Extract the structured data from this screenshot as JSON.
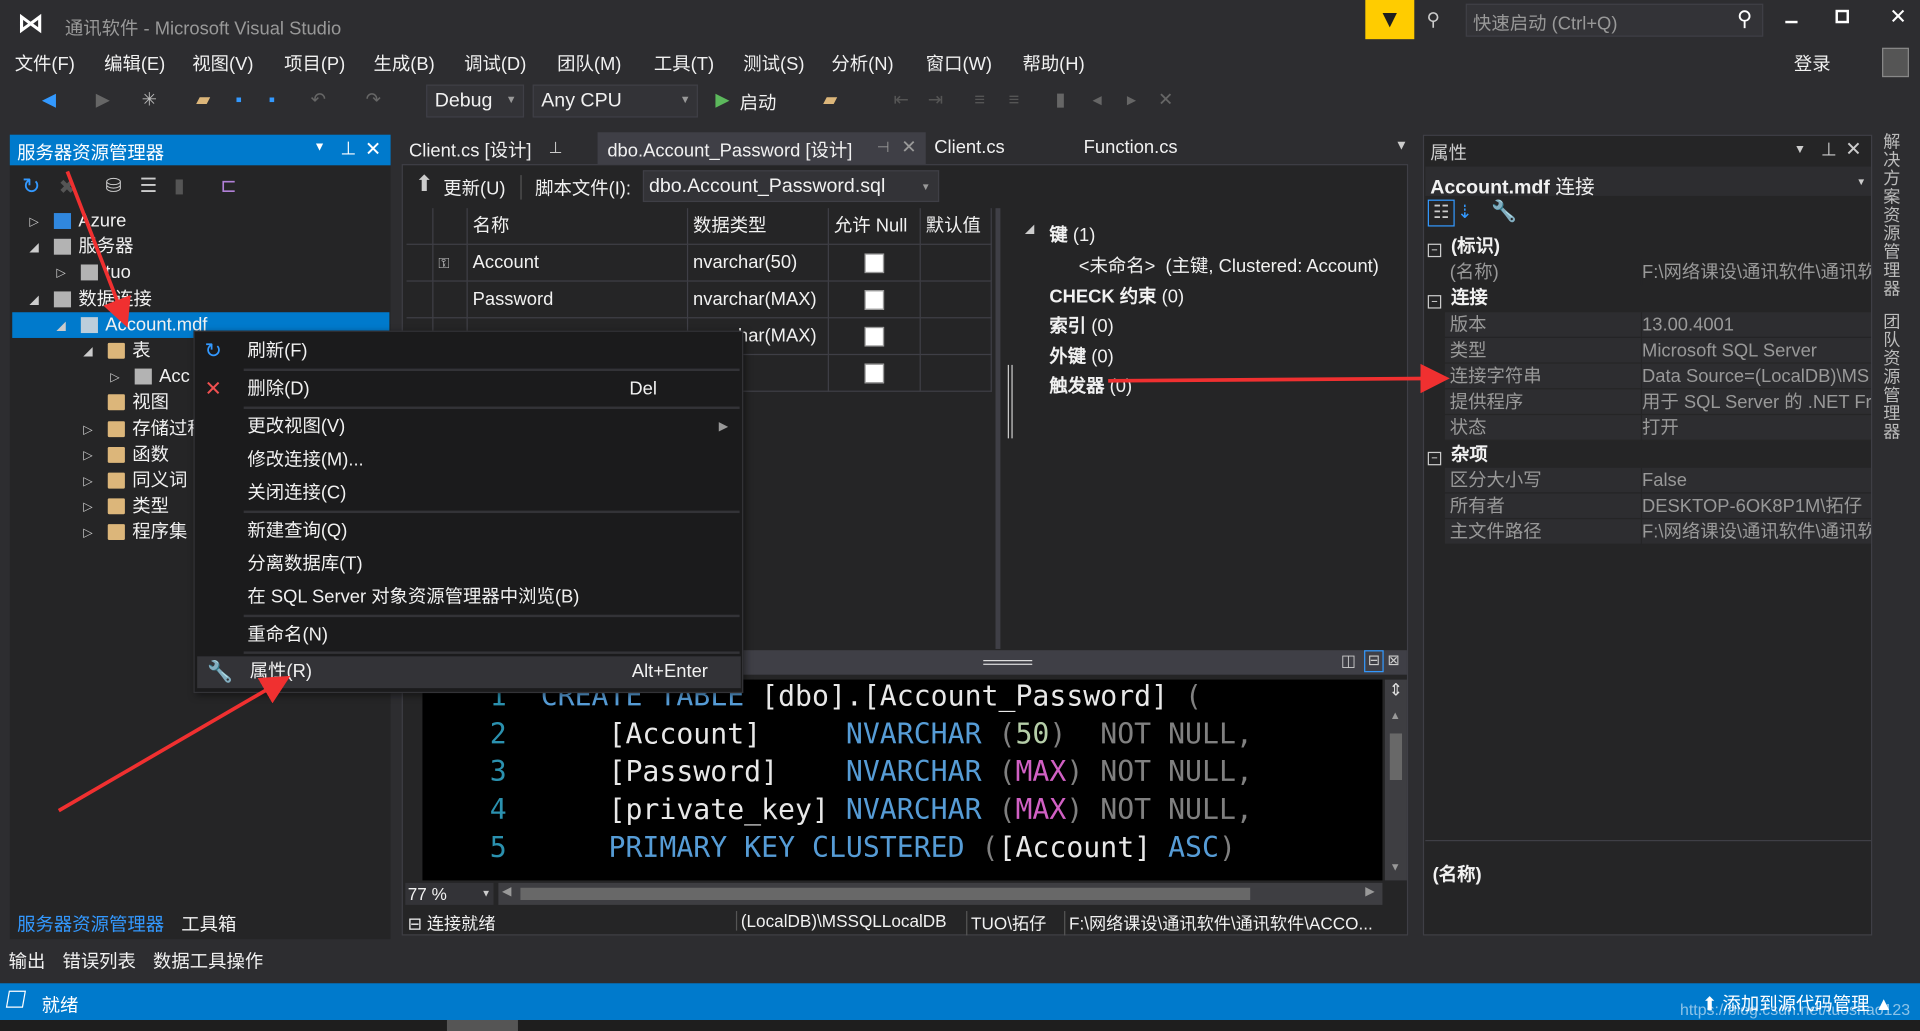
{
  "titlebar": {
    "title": "通讯软件 - Microsoft Visual Studio",
    "quick_launch_placeholder": "快速启动 (Ctrl+Q)",
    "accent": "#ffcc00"
  },
  "menu": {
    "items": [
      "文件(F)",
      "编辑(E)",
      "视图(V)",
      "项目(P)",
      "生成(B)",
      "调试(D)",
      "团队(M)",
      "工具(T)",
      "测试(S)",
      "分析(N)",
      "窗口(W)",
      "帮助(H)"
    ],
    "login": "登录"
  },
  "toolbar": {
    "config": "Debug",
    "platform": "Any CPU",
    "start": "启动"
  },
  "server_explorer": {
    "title": "服务器资源管理器",
    "tree": [
      {
        "label": "Azure",
        "icon": "azure-icon",
        "expander": "collapsed",
        "level": 0
      },
      {
        "label": "服务器",
        "icon": "server-icon",
        "expander": "expanded",
        "level": 0
      },
      {
        "label": "tuo",
        "icon": "computer-icon",
        "expander": "collapsed",
        "level": 1
      },
      {
        "label": "数据连接",
        "icon": "data-connections-icon",
        "expander": "expanded",
        "level": 0
      },
      {
        "label": "Account.mdf",
        "icon": "database-icon",
        "expander": "expanded",
        "level": 1,
        "selected": true
      },
      {
        "label": "表",
        "icon": "folder-icon",
        "expander": "expanded",
        "level": 2
      },
      {
        "label": "Acc",
        "icon": "table-icon",
        "expander": "collapsed",
        "level": 3
      },
      {
        "label": "视图",
        "icon": "folder-icon",
        "expander": "none",
        "level": 2
      },
      {
        "label": "存储过程",
        "icon": "folder-icon",
        "expander": "collapsed",
        "level": 2
      },
      {
        "label": "函数",
        "icon": "folder-icon",
        "expander": "collapsed",
        "level": 2
      },
      {
        "label": "同义词",
        "icon": "folder-icon",
        "expander": "collapsed",
        "level": 2
      },
      {
        "label": "类型",
        "icon": "folder-icon",
        "expander": "collapsed",
        "level": 2
      },
      {
        "label": "程序集",
        "icon": "folder-icon",
        "expander": "collapsed",
        "level": 2
      }
    ],
    "bottom_tabs": [
      "服务器资源管理器",
      "工具箱"
    ]
  },
  "context_menu": {
    "items": [
      {
        "label": "刷新(F)",
        "icon": "refresh-icon",
        "shortcut": ""
      },
      {
        "label": "删除(D)",
        "icon": "delete-icon",
        "shortcut": "Del"
      },
      {
        "label": "更改视图(V)",
        "submenu": true
      },
      {
        "label": "修改连接(M)..."
      },
      {
        "label": "关闭连接(C)"
      },
      {
        "label": "新建查询(Q)"
      },
      {
        "label": "分离数据库(T)"
      },
      {
        "label": "在 SQL Server 对象资源管理器中浏览(B)"
      },
      {
        "label": "重命名(N)"
      },
      {
        "label": "属性(R)",
        "icon": "wrench-icon",
        "shortcut": "Alt+Enter",
        "highlighted": true
      }
    ]
  },
  "editor_tabs": [
    {
      "label": "Client.cs [设计]",
      "pinned": true
    },
    {
      "label": "dbo.Account_Password [设计]",
      "active": true
    },
    {
      "label": "Client.cs"
    },
    {
      "label": "Function.cs"
    }
  ],
  "designer": {
    "update_label": "更新(U)",
    "script_label": "脚本文件(I):",
    "script_file": "dbo.Account_Password.sql",
    "columns": [
      "名称",
      "数据类型",
      "允许 Null",
      "默认值"
    ],
    "rows": [
      {
        "name": "Account",
        "type": "nvarchar(50)",
        "allow_null": false,
        "key": true
      },
      {
        "name": "Password",
        "type": "nvarchar(MAX)",
        "allow_null": false
      },
      {
        "name": "",
        "type": "nvarchar(MAX)",
        "allow_null": false
      },
      {
        "name": "",
        "type": "",
        "allow_null": false
      }
    ],
    "overview": {
      "keys": "键",
      "keys_count": "(1)",
      "key_item_name": "<未命名>",
      "key_item_desc": "(主键, Clustered: Account)",
      "check": "CHECK 约束",
      "check_count": "(0)",
      "index": "索引",
      "index_count": "(0)",
      "fk": "外键",
      "fk_count": "(0)",
      "trigger": "触发器",
      "trigger_count": "(0)"
    },
    "code": [
      [
        [
          "1",
          "ln"
        ],
        [
          "  ",
          ""
        ],
        [
          "CREATE TABLE",
          "kw"
        ],
        [
          " [dbo].[Account_Password] ",
          "tx"
        ],
        [
          "(",
          "gr"
        ]
      ],
      [
        [
          "2",
          "ln"
        ],
        [
          "      [Account]     ",
          "tx"
        ],
        [
          "NVARCHAR",
          "ty"
        ],
        [
          " (",
          "gr"
        ],
        [
          "50",
          "num"
        ],
        [
          ")",
          "gr"
        ],
        [
          "  NOT NULL,",
          "gr"
        ]
      ],
      [
        [
          "3",
          "ln"
        ],
        [
          "      [Password]    ",
          "tx"
        ],
        [
          "NVARCHAR",
          "ty"
        ],
        [
          " (",
          "gr"
        ],
        [
          "MAX",
          "mx"
        ],
        [
          ")",
          "gr"
        ],
        [
          " NOT NULL,",
          "gr"
        ]
      ],
      [
        [
          "4",
          "ln"
        ],
        [
          "      [private_key] ",
          "tx"
        ],
        [
          "NVARCHAR",
          "ty"
        ],
        [
          " (",
          "gr"
        ],
        [
          "MAX",
          "mx"
        ],
        [
          ")",
          "gr"
        ],
        [
          " NOT NULL,",
          "gr"
        ]
      ],
      [
        [
          "5",
          "ln"
        ],
        [
          "      ",
          "tx"
        ],
        [
          "PRIMARY KEY CLUSTERED",
          "kw"
        ],
        [
          " (",
          "gr"
        ],
        [
          "[Account]",
          "tx"
        ],
        [
          " ASC",
          "kw"
        ],
        [
          ")",
          "gr"
        ]
      ]
    ],
    "zoom": "77 %",
    "status": {
      "connection": "连接就绪",
      "server": "(LocalDB)\\MSSQLLocalDB",
      "user": "TUO\\拓仔",
      "path": "F:\\网络课设\\通讯软件\\通讯软件\\ACCO..."
    }
  },
  "properties": {
    "title": "属性",
    "object": "Account.mdf",
    "object_type": "连接",
    "categories": [
      {
        "name": "(标识)",
        "rows": [
          {
            "k": "(名称)",
            "v": "F:\\网络课设\\通讯软件\\通讯软"
          }
        ]
      },
      {
        "name": "连接",
        "rows": [
          {
            "k": "版本",
            "v": "13.00.4001"
          },
          {
            "k": "类型",
            "v": "Microsoft SQL Server"
          },
          {
            "k": "连接字符串",
            "v": "Data Source=(LocalDB)\\MS"
          },
          {
            "k": "提供程序",
            "v": "用于 SQL Server 的 .NET Fra"
          },
          {
            "k": "状态",
            "v": "打开"
          }
        ]
      },
      {
        "name": "杂项",
        "rows": [
          {
            "k": "区分大小写",
            "v": "False"
          },
          {
            "k": "所有者",
            "v": "DESKTOP-6OK8P1M\\拓仔"
          },
          {
            "k": "主文件路径",
            "v": "F:\\网络课设\\通讯软件\\通讯软"
          }
        ]
      }
    ],
    "description_title": "(名称)"
  },
  "side_tabs": [
    "解决方案资源管理器",
    "团队资源管理器"
  ],
  "bottom_tabs": [
    "输出",
    "错误列表",
    "数据工具操作"
  ],
  "statusbar": {
    "text": "就绪",
    "source_control": "添加到源代码管理",
    "watermark": "https://blog.csdn.net/tuoshao123",
    "color": "#007acc"
  }
}
